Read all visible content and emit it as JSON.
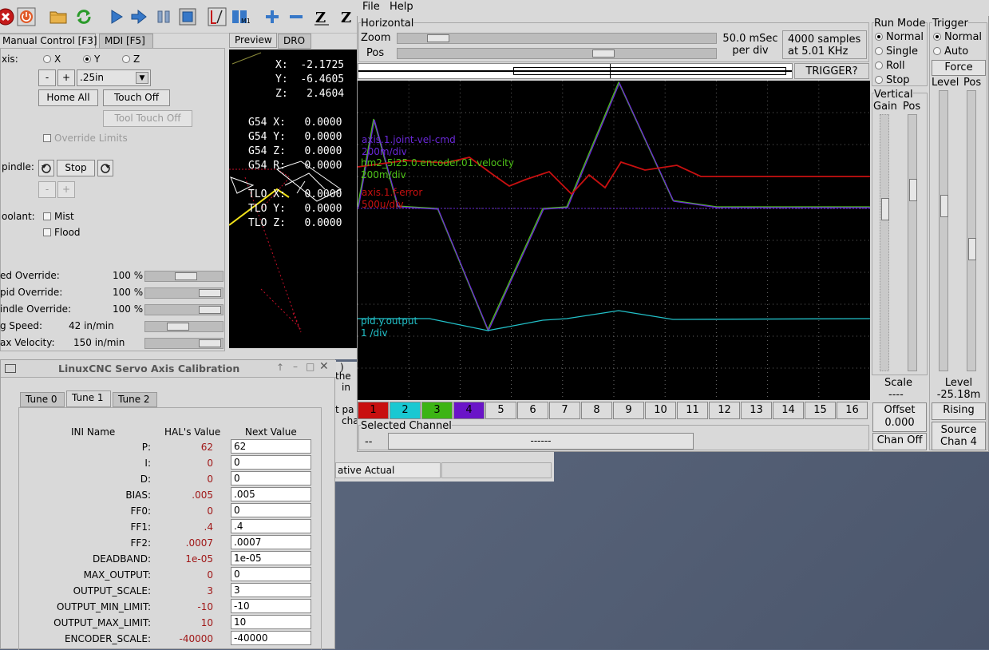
{
  "axis_window": {
    "toolbar_icons": [
      "estop-icon",
      "power-icon",
      "open-file-icon",
      "reload-icon",
      "run-icon",
      "step-icon",
      "pause-icon",
      "stop-icon",
      "block-delete-icon",
      "optional-stop-icon",
      "zoom-in-icon",
      "zoom-out-icon",
      "view-z-icon"
    ],
    "tabs": {
      "manual": "Manual Control [F3]",
      "mdi": "MDI [F5]"
    },
    "axis_label": "xis:",
    "axis_options": [
      "X",
      "Y",
      "Z"
    ],
    "axis_selected": "Y",
    "jog_minus": "-",
    "jog_plus": "+",
    "jog_increment": ".25in",
    "home_all": "Home All",
    "touch_off": "Touch Off",
    "tool_touch_off": "Tool Touch Off",
    "override_limits": "Override Limits",
    "spindle_label": "pindle:",
    "spindle_stop": "Stop",
    "coolant_label": "oolant:",
    "mist": "Mist",
    "flood": "Flood",
    "overrides": [
      {
        "label": "ed Override:",
        "value": "100 %",
        "level": 0.55
      },
      {
        "label": "pid Override:",
        "value": "100 %",
        "level": 1.0
      },
      {
        "label": "indle Override:",
        "value": "100 %",
        "level": 1.0
      },
      {
        "label": "g Speed:",
        "value": "42 in/min",
        "level": 0.4
      },
      {
        "label": "ax Velocity:",
        "value": "150 in/min",
        "level": 1.0
      }
    ],
    "preview_tabs": {
      "preview": "Preview",
      "dro": "DRO"
    },
    "dro": [
      {
        "label": "X:",
        "value": "-2.1725"
      },
      {
        "label": "Y:",
        "value": "-6.4605"
      },
      {
        "label": "Z:",
        "value": "2.4604"
      },
      {
        "label": "G54 X:",
        "value": "0.0000"
      },
      {
        "label": "G54 Y:",
        "value": "0.0000"
      },
      {
        "label": "G54 Z:",
        "value": "0.0000"
      },
      {
        "label": "G54 R:",
        "value": "0.0000"
      },
      {
        "label": "TLO X:",
        "value": "0.0000"
      },
      {
        "label": "TLO Y:",
        "value": "0.0000"
      },
      {
        "label": "TLO Z:",
        "value": "0.0000"
      }
    ]
  },
  "calibration": {
    "title": "LinuxCNC Servo Axis Calibration",
    "tabs": [
      "Tune 0",
      "Tune 1",
      "Tune 2"
    ],
    "active_tab": "Tune 1",
    "headers": {
      "name": "INI Name",
      "hal": "HAL's Value",
      "next": "Next Value"
    },
    "rows": [
      {
        "name": "P:",
        "hal": "62",
        "next": "62"
      },
      {
        "name": "I:",
        "hal": "0",
        "next": "0"
      },
      {
        "name": "D:",
        "hal": "0",
        "next": "0"
      },
      {
        "name": "BIAS:",
        "hal": ".005",
        "next": ".005"
      },
      {
        "name": "FF0:",
        "hal": "0",
        "next": "0"
      },
      {
        "name": "FF1:",
        "hal": ".4",
        "next": ".4"
      },
      {
        "name": "FF2:",
        "hal": ".0007",
        "next": ".0007"
      },
      {
        "name": "DEADBAND:",
        "hal": "1e-05",
        "next": "1e-05"
      },
      {
        "name": "MAX_OUTPUT:",
        "hal": "0",
        "next": "0"
      },
      {
        "name": "OUTPUT_SCALE:",
        "hal": "3",
        "next": "3"
      },
      {
        "name": "OUTPUT_MIN_LIMIT:",
        "hal": "-10",
        "next": "-10"
      },
      {
        "name": "OUTPUT_MAX_LIMIT:",
        "hal": "10",
        "next": "10"
      },
      {
        "name": "ENCODER_SCALE:",
        "hal": "-40000",
        "next": "-40000"
      }
    ]
  },
  "background_text": {
    "lines": [
      ")",
      "the",
      "in",
      "t pa",
      "cha"
    ],
    "status": "ative Actual"
  },
  "halscope": {
    "menu": {
      "file": "File",
      "help": "Help"
    },
    "horizontal": {
      "title": "Horizontal",
      "zoom": "Zoom",
      "pos": "Pos",
      "zoom_level": 0.1,
      "pos_level": 0.66,
      "rate": "50.0 mSec per div",
      "samples": "4000 samples at 5.01 KHz",
      "trigger_state": "TRIGGER?"
    },
    "run_mode": {
      "title": "Run Mode",
      "options": [
        "Normal",
        "Single",
        "Roll",
        "Stop"
      ],
      "selected": "Normal"
    },
    "trigger": {
      "title": "Trigger",
      "options": [
        "Normal",
        "Auto"
      ],
      "selected": "Normal",
      "force": "Force",
      "level": "Level",
      "pos": "Pos",
      "level_value": "Level -25.18m",
      "rising": "Rising",
      "source": "Source Chan 4"
    },
    "vertical": {
      "title": "Vertical",
      "gain": "Gain",
      "pos": "Pos",
      "scale_label": "Scale",
      "scale_value": "----",
      "offset": "Offset 0.000",
      "chan_off": "Chan Off"
    },
    "selected_channel": {
      "title": "Selected Channel",
      "value": "--",
      "name": "------"
    },
    "channels": [
      {
        "num": "1",
        "color": "#c80f0f"
      },
      {
        "num": "2",
        "color": "#19c8d2"
      },
      {
        "num": "3",
        "color": "#3cb414"
      },
      {
        "num": "4",
        "color": "#6a14c8"
      },
      {
        "num": "5"
      },
      {
        "num": "6"
      },
      {
        "num": "7"
      },
      {
        "num": "8"
      },
      {
        "num": "9"
      },
      {
        "num": "10"
      },
      {
        "num": "11"
      },
      {
        "num": "12"
      },
      {
        "num": "13"
      },
      {
        "num": "14"
      },
      {
        "num": "15"
      },
      {
        "num": "16"
      }
    ],
    "traces": [
      {
        "name": "axis.1.joint-vel-cmd",
        "scale": "200m/div",
        "color": "#6a28d8"
      },
      {
        "name": "hm2_5i25.0.encoder.01.velocity",
        "scale": "200m/div",
        "color": "#4ec218"
      },
      {
        "name": "axis.1.f-error",
        "scale": "500u/div",
        "color": "#c81010"
      },
      {
        "name": "pid.y.output",
        "scale": "1 /div",
        "color": "#22c0c8"
      }
    ]
  }
}
